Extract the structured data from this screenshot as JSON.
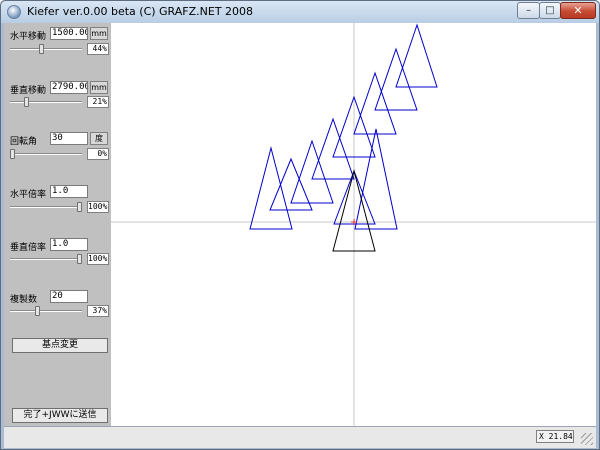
{
  "window": {
    "title": "Kiefer ver.0.00 beta  (C) GRAFZ.NET 2008"
  },
  "controls": {
    "h_move": {
      "label": "水平移動",
      "value": "1500.00",
      "unit": "mm",
      "percent_text": "44%",
      "percent": 44
    },
    "v_move": {
      "label": "垂直移動",
      "value": "2790.00",
      "unit": "mm",
      "percent_text": "21%",
      "percent": 21
    },
    "rotation": {
      "label": "回転角",
      "value": "30",
      "unit": "度",
      "percent_text": "0%",
      "percent": 0
    },
    "h_scale": {
      "label": "水平倍率",
      "value": "1.0",
      "percent_text": "100%",
      "percent": 100
    },
    "v_scale": {
      "label": "垂直倍率",
      "value": "1.0",
      "percent_text": "100%",
      "percent": 100
    },
    "copies": {
      "label": "複製数",
      "value": "20",
      "percent_text": "37%",
      "percent": 37
    }
  },
  "buttons": {
    "change_base": "基点変更",
    "finish": "完了+JWWに送信"
  },
  "status": {
    "coord": "X 21.84"
  },
  "icons": {
    "app": "app-globe-icon",
    "minimize": "minimize-icon",
    "maximize": "maximize-icon",
    "close": "close-icon"
  },
  "colors": {
    "original_shape": "#000000",
    "copy_shape": "#0000cc",
    "axis": "#c8c8c8",
    "origin_marker": "#e03030"
  }
}
